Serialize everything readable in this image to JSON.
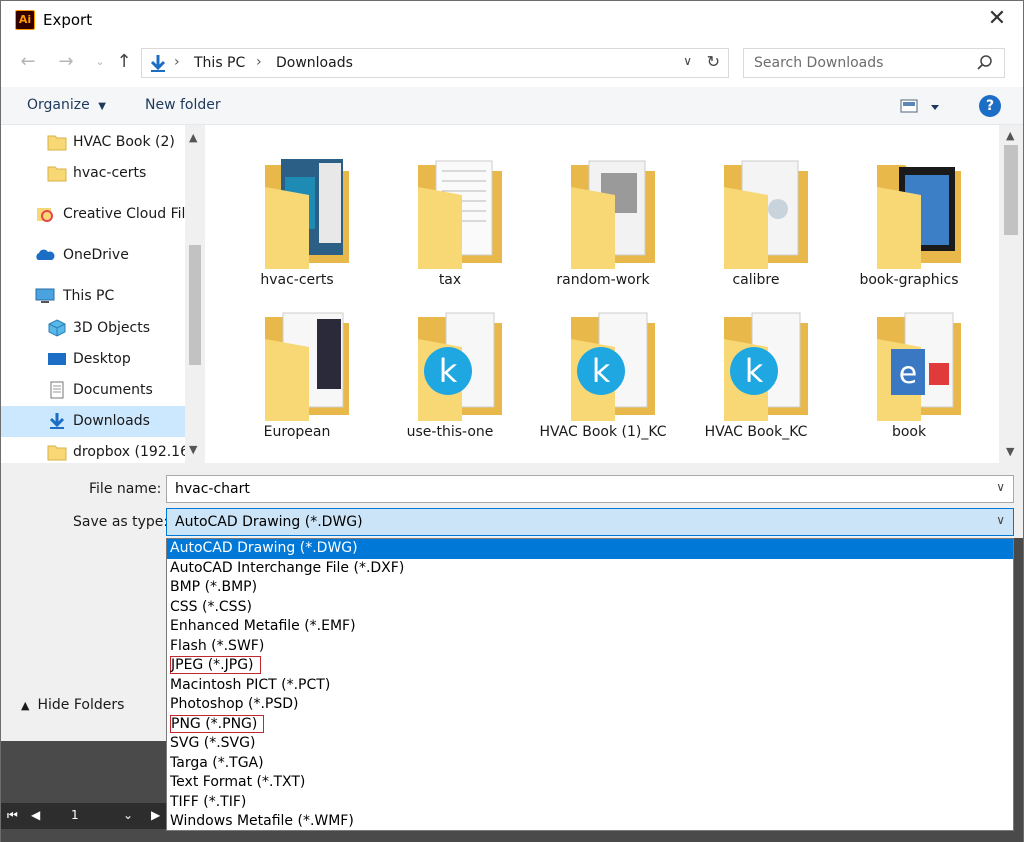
{
  "window": {
    "title": "Export",
    "app_icon_text": "Ai"
  },
  "nav": {
    "breadcrumb": [
      "This PC",
      "Downloads"
    ],
    "search_placeholder": "Search Downloads"
  },
  "commands": {
    "organize": "Organize",
    "new_folder": "New folder",
    "help": "?"
  },
  "sidebar": {
    "items": [
      {
        "label": "HVAC Book (2)",
        "icon": "folder-icon"
      },
      {
        "label": "hvac-certs",
        "icon": "folder-icon"
      },
      {
        "label": "Creative Cloud Fil",
        "icon": "creative-cloud-icon"
      },
      {
        "label": "OneDrive",
        "icon": "onedrive-icon"
      },
      {
        "label": "This PC",
        "icon": "computer-icon"
      },
      {
        "label": "3D Objects",
        "icon": "cube-icon"
      },
      {
        "label": "Desktop",
        "icon": "desktop-icon"
      },
      {
        "label": "Documents",
        "icon": "documents-icon"
      },
      {
        "label": "Downloads",
        "icon": "downloads-icon"
      },
      {
        "label": "dropbox (192.16",
        "icon": "network-folder-icon"
      }
    ]
  },
  "folders": [
    {
      "name": "hvac-certs"
    },
    {
      "name": "tax"
    },
    {
      "name": "random-work"
    },
    {
      "name": "calibre"
    },
    {
      "name": "book-graphics"
    },
    {
      "name": "European"
    },
    {
      "name": "use-this-one"
    },
    {
      "name": "HVAC Book (1)_KC"
    },
    {
      "name": "HVAC Book_KC"
    },
    {
      "name": "book"
    }
  ],
  "form": {
    "file_name_label": "File name:",
    "file_name_value": "hvac-chart",
    "save_type_label": "Save as type:",
    "save_type_value": "AutoCAD Drawing (*.DWG)",
    "hide_folders": "Hide Folders"
  },
  "save_types": [
    "AutoCAD Drawing (*.DWG)",
    "AutoCAD Interchange File (*.DXF)",
    "BMP (*.BMP)",
    "CSS (*.CSS)",
    "Enhanced Metafile (*.EMF)",
    "Flash (*.SWF)",
    "JPEG (*.JPG)",
    "Macintosh PICT (*.PCT)",
    "Photoshop (*.PSD)",
    "PNG (*.PNG)",
    "SVG (*.SVG)",
    "Targa (*.TGA)",
    "Text Format (*.TXT)",
    "TIFF (*.TIF)",
    "Windows Metafile (*.WMF)"
  ],
  "highlighted_types": [
    "JPEG (*.JPG)",
    "PNG (*.PNG)"
  ],
  "background_app": {
    "page_number": "1"
  },
  "colors": {
    "accent": "#0078d7",
    "highlight_box": "#c0282d",
    "folder": "#f8d775"
  }
}
